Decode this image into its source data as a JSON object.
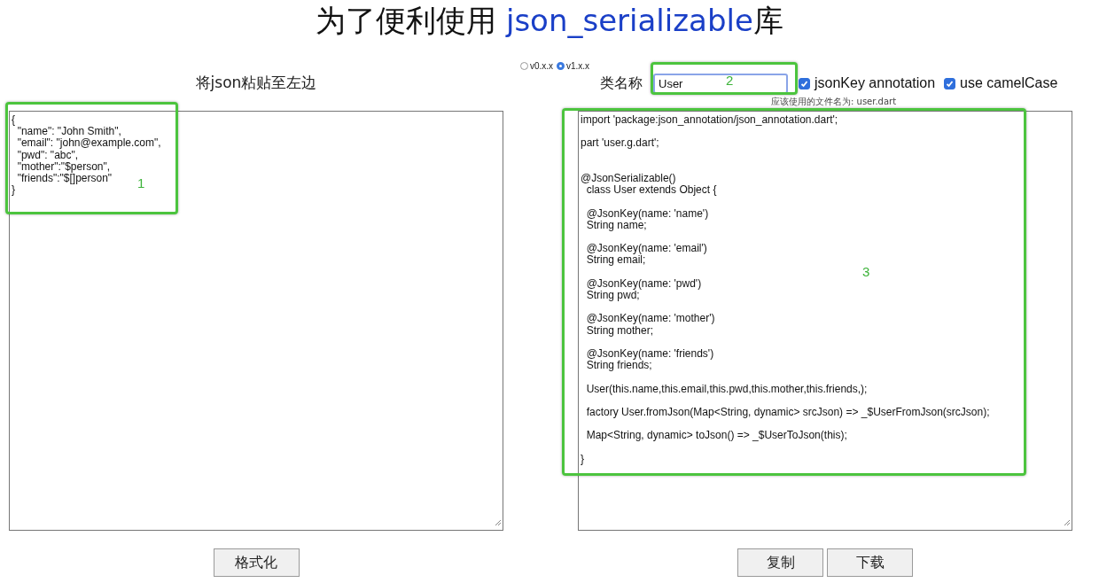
{
  "title": {
    "text": "为了便利使用 ",
    "highlight": "json_serializable",
    "suffix": "库"
  },
  "versions": [
    {
      "label": "v0.x.x",
      "selected": false
    },
    {
      "label": "v1.x.x",
      "selected": true
    }
  ],
  "input_panel": {
    "label": "将json粘贴至左边",
    "value": "{\n  \"name\": \"John Smith\",\n  \"email\": \"john@example.com\",\n  \"pwd\": \"abc\",\n  \"mother\":\"$person\",\n  \"friends\":\"$[]person\"\n}"
  },
  "class_name": {
    "label": "类名称",
    "value": "User"
  },
  "options": [
    {
      "label": "jsonKey annotation",
      "checked": true
    },
    {
      "label": "use camelCase",
      "checked": true
    }
  ],
  "file_hint": "应该使用的文件名为: user.dart",
  "output": {
    "value": "import 'package:json_annotation/json_annotation.dart';\n\npart 'user.g.dart';\n\n\n@JsonSerializable()\n  class User extends Object {\n\n  @JsonKey(name: 'name')\n  String name;\n\n  @JsonKey(name: 'email')\n  String email;\n\n  @JsonKey(name: 'pwd')\n  String pwd;\n\n  @JsonKey(name: 'mother')\n  String mother;\n\n  @JsonKey(name: 'friends')\n  String friends;\n\n  User(this.name,this.email,this.pwd,this.mother,this.friends,);\n\n  factory User.fromJson(Map<String, dynamic> srcJson) => _$UserFromJson(srcJson);\n\n  Map<String, dynamic> toJson() => _$UserToJson(this);\n\n}"
  },
  "buttons_left": [
    "格式化"
  ],
  "buttons_right": [
    "复制",
    "下载"
  ],
  "annotations": [
    {
      "label": "1"
    },
    {
      "label": "2"
    },
    {
      "label": "3"
    }
  ]
}
